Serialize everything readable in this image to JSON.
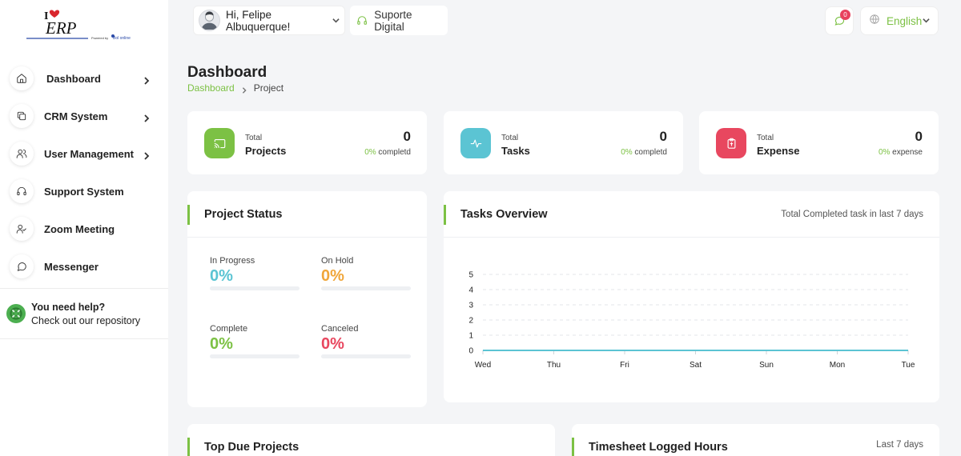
{
  "brand": {
    "logo_text": "ERP",
    "logo_prefix": "I",
    "powered_by": "Powered by",
    "powered_name": "Bol online"
  },
  "sidebar": {
    "items": [
      {
        "label": "Dashboard",
        "icon": "home-icon",
        "has_children": true
      },
      {
        "label": "CRM System",
        "icon": "copy-icon",
        "has_children": true
      },
      {
        "label": "User Management",
        "icon": "users-icon",
        "has_children": true
      },
      {
        "label": "Support System",
        "icon": "headset-icon",
        "has_children": false
      },
      {
        "label": "Zoom Meeting",
        "icon": "user-check-icon",
        "has_children": false
      },
      {
        "label": "Messenger",
        "icon": "chat-icon",
        "has_children": false
      }
    ],
    "help": {
      "title": "You need help?",
      "subtitle": "Check out our repository"
    }
  },
  "header": {
    "greeting": "Hi, Felipe Albuquerque!",
    "support_label": "Suporte Digital",
    "notifications_count": "0",
    "language": "English"
  },
  "page": {
    "title": "Dashboard",
    "breadcrumb": {
      "root": "Dashboard",
      "current": "Project"
    }
  },
  "stats": [
    {
      "small": "Total",
      "title": "Projects",
      "value": "0",
      "pct": "0%",
      "suffix": " completd",
      "color": "#7cc144",
      "icon": "cast-icon"
    },
    {
      "small": "Total",
      "title": "Tasks",
      "value": "0",
      "pct": "0%",
      "suffix": " completd",
      "color": "#5bc4d3",
      "icon": "activity-icon"
    },
    {
      "small": "Total",
      "title": "Expense",
      "value": "0",
      "pct": "0%",
      "suffix": " expense",
      "color": "#e8475f",
      "icon": "clipboard-icon"
    }
  ],
  "project_status": {
    "title": "Project Status",
    "items": [
      {
        "label": "In Progress",
        "value": "0%",
        "progress": 0,
        "color": "#5bc4d3"
      },
      {
        "label": "On Hold",
        "value": "0%",
        "progress": 0,
        "color": "#f0a63a"
      },
      {
        "label": "Complete",
        "value": "0%",
        "progress": 0,
        "color": "#7cc144"
      },
      {
        "label": "Canceled",
        "value": "0%",
        "progress": 0,
        "color": "#e8475f"
      }
    ]
  },
  "tasks_overview": {
    "title": "Tasks Overview",
    "subtitle": "Total Completed task in last 7 days"
  },
  "chart_data": {
    "type": "line",
    "categories": [
      "Wed",
      "Thu",
      "Fri",
      "Sat",
      "Sun",
      "Mon",
      "Tue"
    ],
    "series": [
      {
        "values": [
          0,
          0,
          0,
          0,
          0,
          0,
          0
        ],
        "color": "#5bc4d3"
      }
    ],
    "yticks": [
      0,
      1,
      2,
      3,
      4,
      5
    ],
    "ylim": [
      0,
      5
    ],
    "grid": true,
    "title": "",
    "xlabel": "",
    "ylabel": ""
  },
  "top_due_projects": {
    "title": "Top Due Projects"
  },
  "timesheet": {
    "title": "Timesheet Logged Hours",
    "subtitle": "Last 7 days"
  }
}
